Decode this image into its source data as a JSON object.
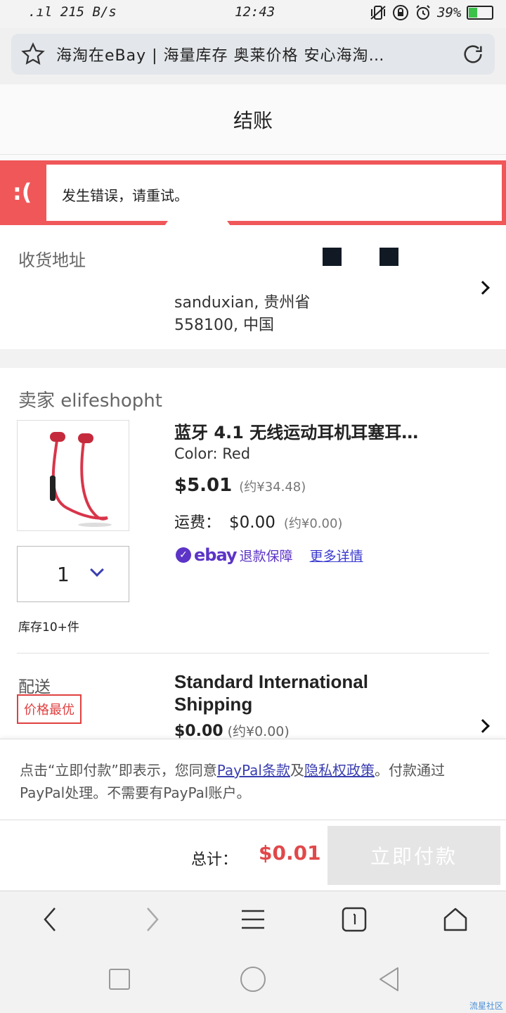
{
  "status_bar": {
    "network_speed": ".ıl 215 B/s",
    "time": "12:43",
    "battery_percent": "39%",
    "battery_level": 0.39
  },
  "browser": {
    "url_title": "海淘在eBay | 海量库存 奥莱价格 安心海淘…"
  },
  "header": {
    "title": "结账"
  },
  "error": {
    "face": ":(",
    "message": "发生错误，请重试。"
  },
  "address": {
    "label": "收货地址",
    "line1": "sanduxian, 贵州省",
    "line2": "558100, 中国"
  },
  "order": {
    "seller_label": "卖家 elifeshopht",
    "item": {
      "title": "蓝牙 4.1 无线运动耳机耳塞耳…",
      "color": "Color: Red",
      "price": "$5.01",
      "price_approx": "(约¥34.48)",
      "shipping_label": "运费：",
      "shipping_value": "$0.00",
      "shipping_approx": "(约¥0.00)",
      "guarantee_brand": "ebay",
      "guarantee_text": "退款保障",
      "more_details": "更多详情",
      "quantity": "1",
      "stock": "库存10+件"
    },
    "delivery": {
      "label": "配送",
      "badge": "价格最优",
      "method": "Standard International Shipping",
      "price": "$0.00",
      "price_approx": "(约¥0.00)"
    }
  },
  "terms": {
    "text_before": "点击“立即付款”即表示，您同意",
    "paypal_terms": "PayPal条款",
    "and": "及",
    "privacy": "隐私权政策",
    "text_after": "。付款通过PayPal处理。不需要有PayPal账户。"
  },
  "total": {
    "label": "总计：",
    "value": "$0.01",
    "pay_button": "立即付款"
  },
  "watermark": "流星社区"
}
